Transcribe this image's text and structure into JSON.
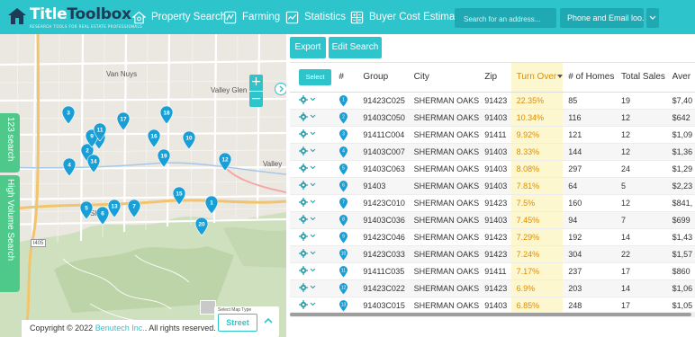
{
  "brand": {
    "name_part1": "Title",
    "name_part2": "Toolbox",
    "tagline": "RESEARCH TOOLS FOR REAL ESTATE PROFESSIONALS"
  },
  "nav": [
    {
      "label": "Property Search",
      "icon": "home-search-icon"
    },
    {
      "label": "Farming",
      "icon": "map-icon"
    },
    {
      "label": "Statistics",
      "icon": "chart-icon"
    },
    {
      "label": "Buyer Cost Estimate",
      "icon": "calculator-icon"
    }
  ],
  "search": {
    "placeholder": "Search for an address..."
  },
  "filter": {
    "selected": "Phone and Email loo..."
  },
  "map": {
    "labels": {
      "van_nuys": "Van Nuys",
      "valley_glen": "Valley Glen",
      "valley": "Valley",
      "sherman": "Sher",
      "i405": "I405"
    },
    "side_tabs": [
      "123 search",
      "High Volume Search"
    ],
    "map_type_label": "Select Map Type",
    "map_type": "Street",
    "zoom_in": "+",
    "zoom_out": "−",
    "pins": [
      "1",
      "2",
      "3",
      "4",
      "5",
      "6",
      "7",
      "8",
      "9",
      "10",
      "11",
      "12",
      "13",
      "14",
      "15",
      "16",
      "17",
      "18",
      "19",
      "20"
    ],
    "pin_color": "#1a9ed6"
  },
  "copyright": {
    "prefix": "Copyright © 2022",
    "company": "Benutech Inc.",
    "suffix": ". All rights reserved."
  },
  "toolbar": {
    "export_label": "Export",
    "edit_search_label": "Edit Search"
  },
  "table": {
    "select_label": "Select",
    "columns": [
      "#",
      "Group",
      "City",
      "Zip",
      "Turn Over",
      "# of Homes",
      "Total Sales",
      "Aver"
    ],
    "rows": [
      {
        "n": "1",
        "group": "91423C025",
        "city": "SHERMAN OAKS",
        "zip": "91423",
        "turnover": "22.35%",
        "homes": "85",
        "sales": "19",
        "avg": "$7,40"
      },
      {
        "n": "2",
        "group": "91403C050",
        "city": "SHERMAN OAKS",
        "zip": "91403",
        "turnover": "10.34%",
        "homes": "116",
        "sales": "12",
        "avg": "$642"
      },
      {
        "n": "3",
        "group": "91411C004",
        "city": "SHERMAN OAKS",
        "zip": "91411",
        "turnover": "9.92%",
        "homes": "121",
        "sales": "12",
        "avg": "$1,09"
      },
      {
        "n": "4",
        "group": "91403C007",
        "city": "SHERMAN OAKS",
        "zip": "91403",
        "turnover": "8.33%",
        "homes": "144",
        "sales": "12",
        "avg": "$1,36"
      },
      {
        "n": "5",
        "group": "91403C063",
        "city": "SHERMAN OAKS",
        "zip": "91403",
        "turnover": "8.08%",
        "homes": "297",
        "sales": "24",
        "avg": "$1,29"
      },
      {
        "n": "6",
        "group": "91403",
        "city": "SHERMAN OAKS",
        "zip": "91403",
        "turnover": "7.81%",
        "homes": "64",
        "sales": "5",
        "avg": "$2,23"
      },
      {
        "n": "7",
        "group": "91423C010",
        "city": "SHERMAN OAKS",
        "zip": "91423",
        "turnover": "7.5%",
        "homes": "160",
        "sales": "12",
        "avg": "$841,"
      },
      {
        "n": "8",
        "group": "91403C036",
        "city": "SHERMAN OAKS",
        "zip": "91403",
        "turnover": "7.45%",
        "homes": "94",
        "sales": "7",
        "avg": "$699"
      },
      {
        "n": "9",
        "group": "91423C046",
        "city": "SHERMAN OAKS",
        "zip": "91423",
        "turnover": "7.29%",
        "homes": "192",
        "sales": "14",
        "avg": "$1,43"
      },
      {
        "n": "10",
        "group": "91423C033",
        "city": "SHERMAN OAKS",
        "zip": "91423",
        "turnover": "7.24%",
        "homes": "304",
        "sales": "22",
        "avg": "$1,57"
      },
      {
        "n": "11",
        "group": "91411C035",
        "city": "SHERMAN OAKS",
        "zip": "91411",
        "turnover": "7.17%",
        "homes": "237",
        "sales": "17",
        "avg": "$860"
      },
      {
        "n": "12",
        "group": "91423C022",
        "city": "SHERMAN OAKS",
        "zip": "91423",
        "turnover": "6.9%",
        "homes": "203",
        "sales": "14",
        "avg": "$1,06"
      },
      {
        "n": "13",
        "group": "91403C015",
        "city": "SHERMAN OAKS",
        "zip": "91403",
        "turnover": "6.85%",
        "homes": "248",
        "sales": "17",
        "avg": "$1,05"
      }
    ]
  },
  "colors": {
    "accent": "#2ec4cc",
    "green": "#4ec98a",
    "turnover_bg": "#fdf7cf",
    "turnover_text": "#e08c00"
  }
}
